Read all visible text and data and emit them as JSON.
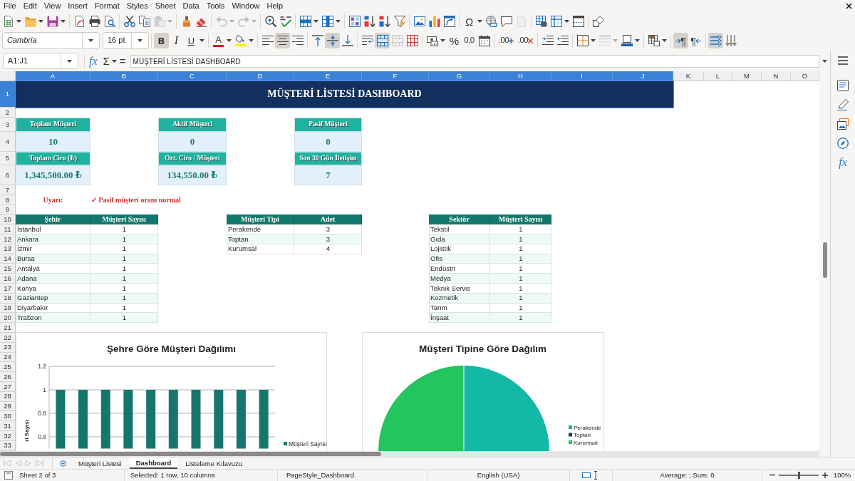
{
  "menu_bar": {
    "items": [
      "File",
      "Edit",
      "View",
      "Insert",
      "Format",
      "Styles",
      "Sheet",
      "Data",
      "Tools",
      "Window",
      "Help"
    ]
  },
  "standard_toolbar": {
    "groups": [
      [
        {
          "kind": "new",
          "dropdown": true,
          "disabled": false
        },
        {
          "kind": "open",
          "dropdown": true,
          "disabled": false
        },
        {
          "kind": "save",
          "dropdown": true,
          "disabled": false
        }
      ],
      [
        {
          "kind": "pdf",
          "disabled": false
        },
        {
          "kind": "print",
          "disabled": false
        },
        {
          "kind": "preview",
          "disabled": false
        }
      ],
      [
        {
          "kind": "cut",
          "disabled": false
        },
        {
          "kind": "copy",
          "disabled": false
        },
        {
          "kind": "paste",
          "dropdown": true,
          "disabled": true
        }
      ],
      [
        {
          "kind": "clone",
          "disabled": false
        },
        {
          "kind": "clear",
          "disabled": false
        }
      ],
      [
        {
          "kind": "undo",
          "dropdown": true,
          "disabled": true
        },
        {
          "kind": "redo",
          "dropdown": true,
          "disabled": true
        }
      ],
      [
        {
          "kind": "find",
          "disabled": false
        },
        {
          "kind": "spelling",
          "disabled": false
        }
      ],
      [
        {
          "kind": "row",
          "dropdown": true,
          "disabled": false
        },
        {
          "kind": "column",
          "dropdown": true,
          "disabled": false
        }
      ],
      [
        {
          "kind": "sort",
          "disabled": false
        },
        {
          "kind": "sortup",
          "disabled": false
        },
        {
          "kind": "sortdown",
          "disabled": false
        },
        {
          "kind": "filter",
          "disabled": false
        }
      ],
      [
        {
          "kind": "image",
          "disabled": false
        },
        {
          "kind": "chart",
          "disabled": false
        },
        {
          "kind": "pivot",
          "disabled": false
        }
      ],
      [
        {
          "kind": "special",
          "glyph": "Ω",
          "dropdown": true,
          "disabled": false
        },
        {
          "kind": "link",
          "disabled": false
        },
        {
          "kind": "comment",
          "disabled": false
        },
        {
          "kind": "headerfooter",
          "disabled": true
        }
      ],
      [
        {
          "kind": "printarea",
          "disabled": false
        },
        {
          "kind": "freeze",
          "dropdown": true,
          "disabled": false
        },
        {
          "kind": "split",
          "disabled": false
        }
      ],
      [
        {
          "kind": "shapes",
          "disabled": false
        }
      ]
    ]
  },
  "formatting_toolbar": {
    "font_name": "Cambria",
    "font_size": "16 pt",
    "groups": [
      [
        {
          "kind": "bold",
          "glyph": "B",
          "pressed": true,
          "disabled": false
        },
        {
          "kind": "italic",
          "glyph": "I",
          "pressed": false,
          "disabled": false
        },
        {
          "kind": "underline",
          "glyph": "U",
          "dropdown": true,
          "pressed": false,
          "disabled": false
        }
      ],
      [
        {
          "kind": "fontcolor",
          "glyph": "A",
          "dropdown": true,
          "pressed": false,
          "disabled": false
        },
        {
          "kind": "highlight",
          "dropdown": true,
          "pressed": false,
          "disabled": false
        }
      ],
      [
        {
          "kind": "alignleft",
          "pressed": false,
          "disabled": false
        },
        {
          "kind": "aligncenter",
          "pressed": true,
          "disabled": false
        },
        {
          "kind": "alignright",
          "pressed": false,
          "disabled": false
        }
      ],
      [
        {
          "kind": "aligntop",
          "pressed": false,
          "disabled": false
        },
        {
          "kind": "alignmiddle",
          "pressed": true,
          "disabled": false
        },
        {
          "kind": "alignbottom",
          "pressed": false,
          "disabled": false
        }
      ],
      [
        {
          "kind": "wrap",
          "pressed": false,
          "disabled": false
        },
        {
          "kind": "mergecenter",
          "pressed": true,
          "disabled": false
        },
        {
          "kind": "merge",
          "pressed": false,
          "disabled": true
        },
        {
          "kind": "unmerge",
          "pressed": false,
          "disabled": false
        }
      ],
      [
        {
          "kind": "currency",
          "dropdown": true,
          "pressed": false,
          "disabled": false
        },
        {
          "kind": "percent",
          "glyph": "%",
          "pressed": false,
          "disabled": false
        },
        {
          "kind": "number",
          "glyph": "0.0",
          "pressed": false,
          "disabled": false
        },
        {
          "kind": "date",
          "pressed": false,
          "disabled": false
        }
      ],
      [
        {
          "kind": "adddecimal",
          "glyph": ".00",
          "pressed": false,
          "disabled": false
        },
        {
          "kind": "deldecimal",
          "glyph": ".00",
          "pressed": false,
          "disabled": false
        }
      ],
      [
        {
          "kind": "indent",
          "pressed": false,
          "disabled": false
        },
        {
          "kind": "outdent",
          "pressed": false,
          "disabled": false
        }
      ],
      [
        {
          "kind": "borders",
          "dropdown": true,
          "pressed": false,
          "disabled": false
        },
        {
          "kind": "borderstyle",
          "dropdown": true,
          "pressed": false,
          "disabled": true
        },
        {
          "kind": "bordercolor",
          "dropdown": true,
          "pressed": false,
          "disabled": false
        }
      ],
      [
        {
          "kind": "conditional",
          "dropdown": true,
          "pressed": false,
          "disabled": false
        }
      ],
      [
        {
          "kind": "ltr",
          "glyph": "¶",
          "pressed": true,
          "disabled": false
        },
        {
          "kind": "rtl",
          "glyph": "¶",
          "pressed": false,
          "disabled": false
        }
      ],
      [
        {
          "kind": "texthorizontal",
          "pressed": true,
          "disabled": false
        },
        {
          "kind": "textvertical",
          "pressed": false,
          "disabled": false
        }
      ]
    ]
  },
  "formula_bar": {
    "name_box": "A1:J1",
    "function_glyph": "fx",
    "sum_glyph": "Σ",
    "equals_glyph": "=",
    "content": "MÜŞTERİ LİSTESİ DASHBOARD"
  },
  "sidebar": {
    "functions_glyph": "fx"
  },
  "sheet": {
    "columns": [
      {
        "label": "A",
        "selected": true
      },
      {
        "label": "B",
        "selected": true
      },
      {
        "label": "C",
        "selected": true
      },
      {
        "label": "D",
        "selected": true
      },
      {
        "label": "E",
        "selected": true
      },
      {
        "label": "F",
        "selected": true
      },
      {
        "label": "G",
        "selected": true
      },
      {
        "label": "H",
        "selected": true
      },
      {
        "label": "I",
        "selected": true
      },
      {
        "label": "J",
        "selected": true
      },
      {
        "label": "K",
        "selected": false
      },
      {
        "label": "L",
        "selected": false
      },
      {
        "label": "M",
        "selected": false
      },
      {
        "label": "N",
        "selected": false
      },
      {
        "label": "O",
        "selected": false
      }
    ],
    "rows": [
      {
        "label": "1",
        "selected": true
      },
      {
        "label": "2",
        "selected": false
      },
      {
        "label": "3",
        "selected": false
      },
      {
        "label": "4",
        "selected": false
      },
      {
        "label": "5",
        "selected": false
      },
      {
        "label": "6",
        "selected": false
      },
      {
        "label": "7",
        "selected": false
      },
      {
        "label": "8",
        "selected": false
      },
      {
        "label": "9",
        "selected": false
      },
      {
        "label": "10",
        "selected": false
      },
      {
        "label": "11",
        "selected": false
      },
      {
        "label": "12",
        "selected": false
      },
      {
        "label": "13",
        "selected": false
      },
      {
        "label": "14",
        "selected": false
      },
      {
        "label": "15",
        "selected": false
      },
      {
        "label": "16",
        "selected": false
      },
      {
        "label": "17",
        "selected": false
      },
      {
        "label": "18",
        "selected": false
      },
      {
        "label": "19",
        "selected": false
      },
      {
        "label": "20",
        "selected": false
      },
      {
        "label": "21",
        "selected": false
      },
      {
        "label": "22",
        "selected": false
      },
      {
        "label": "23",
        "selected": false
      },
      {
        "label": "24",
        "selected": false
      },
      {
        "label": "25",
        "selected": false
      },
      {
        "label": "26",
        "selected": false
      },
      {
        "label": "27",
        "selected": false
      },
      {
        "label": "28",
        "selected": false
      },
      {
        "label": "29",
        "selected": false
      },
      {
        "label": "30",
        "selected": false
      },
      {
        "label": "31",
        "selected": false
      },
      {
        "label": "32",
        "selected": false
      },
      {
        "label": "33",
        "selected": false
      }
    ],
    "title": {
      "text": "MÜŞTERİ LİSTESİ DASHBOARD",
      "selected": true
    },
    "metrics": [
      {
        "label": "Toplam Müşteri",
        "value": "10"
      },
      {
        "label": "Aktif Müşteri",
        "value": "0"
      },
      {
        "label": "Pasif Müşteri",
        "value": "0"
      },
      {
        "label": "Toplam Ciro (₺)",
        "value": "1,345,500.00 ₺"
      },
      {
        "label": "Ort. Ciro / Müşteri",
        "value": "134,550.00 ₺"
      },
      {
        "label": "Son 30 Gün İletişim",
        "value": "7"
      }
    ],
    "warning": {
      "label": "Uyarı:",
      "message": "✓ Pasif müşteri oranı normal"
    },
    "tables": [
      {
        "columns": [
          "Şehir",
          "Müşteri Sayısı"
        ],
        "rows": [
          [
            "İstanbul",
            "1"
          ],
          [
            "Ankara",
            "1"
          ],
          [
            "İzmir",
            "1"
          ],
          [
            "Bursa",
            "1"
          ],
          [
            "Antalya",
            "1"
          ],
          [
            "Adana",
            "1"
          ],
          [
            "Konya",
            "1"
          ],
          [
            "Gaziantep",
            "1"
          ],
          [
            "Diyarbakır",
            "1"
          ],
          [
            "Trabzon",
            "1"
          ]
        ]
      },
      {
        "columns": [
          "Müşteri Tipi",
          "Adet"
        ],
        "rows": [
          [
            "Perakende",
            "3"
          ],
          [
            "Toptan",
            "3"
          ],
          [
            "Kurumsal",
            "4"
          ]
        ]
      },
      {
        "columns": [
          "Sektör",
          "Müşteri Sayısı"
        ],
        "rows": [
          [
            "Tekstil",
            "1"
          ],
          [
            "Gıda",
            "1"
          ],
          [
            "Lojistik",
            "1"
          ],
          [
            "Ofis",
            "1"
          ],
          [
            "Endüstri",
            "1"
          ],
          [
            "Medya",
            "1"
          ],
          [
            "Teknik Servis",
            "1"
          ],
          [
            "Kozmetik",
            "1"
          ],
          [
            "Tarım",
            "1"
          ],
          [
            "İnşaat",
            "1"
          ]
        ]
      }
    ],
    "city_chart": {
      "chart_data": {
        "type": "bar",
        "title": "Şehre Göre Müşteri Dağılımı",
        "ylabel": "ri Sayısı",
        "series": [
          {
            "name": "Müşteri Sayısı",
            "color": "#17766c",
            "values": [
              1,
              1,
              1,
              1,
              1,
              1,
              1,
              1,
              1,
              1
            ]
          }
        ],
        "ylim": [
          0.5,
          1.2
        ],
        "yticks": [
          0.6,
          0.8,
          1,
          1.2
        ],
        "grid": true
      }
    },
    "type_chart": {
      "title": "Müşteri Tipine Göre Dağılım",
      "legend": [
        {
          "label": "Perakende",
          "color": "#14b8a6"
        },
        {
          "label": "Toptan",
          "color": "#1e3a5f"
        },
        {
          "label": "Kurumsal",
          "color": "#22c55e"
        }
      ]
    }
  },
  "sheet_tabs": {
    "navigation_disabled": true,
    "tabs": [
      {
        "label": "Müşteri Listesi",
        "selected": false
      },
      {
        "label": "Dashboard",
        "selected": true
      },
      {
        "label": "Listeleme Kılavuzu",
        "selected": false
      }
    ]
  },
  "status_bar": {
    "sheet": "Sheet 2 of 3",
    "selection": "Selected: 1 row, 10 columns",
    "page_style": "PageStyle_Dashboard",
    "language": "English (USA)",
    "summary": "Average: ; Sum: 0",
    "zoom_slider": {
      "level": 0.5
    },
    "zoom": "100%"
  }
}
